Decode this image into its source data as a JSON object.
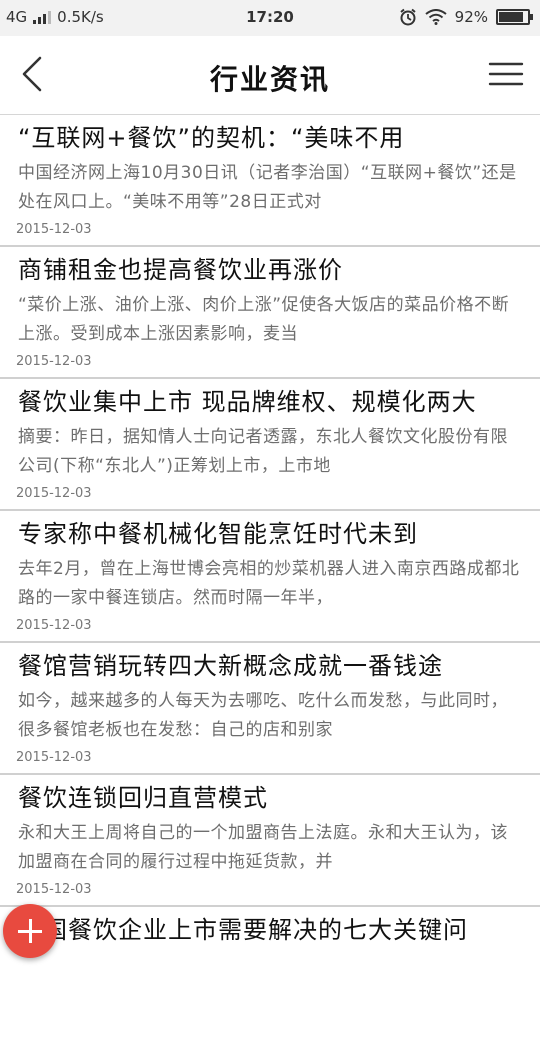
{
  "status_bar": {
    "network": "4G",
    "speed": "0.5K/s",
    "time": "17:20",
    "battery": "92%",
    "battery_level": 0.92,
    "icons": [
      "signal-icon",
      "alarm-icon",
      "wifi-icon",
      "battery-icon"
    ]
  },
  "header": {
    "title": "行业资讯",
    "back_icon": "back-icon",
    "menu_icon": "menu-icon"
  },
  "news": [
    {
      "title": "“互联网+餐饮”的契机：“美味不用",
      "summary": "中国经济网上海10月30日讯（记者李治国）“互联网+餐饮”还是处在风口上。“美味不用等”28日正式对",
      "date": "2015-12-03"
    },
    {
      "title": "商铺租金也提高餐饮业再涨价",
      "summary": "“菜价上涨、油价上涨、肉价上涨”促使各大饭店的菜品价格不断上涨。受到成本上涨因素影响，麦当",
      "date": "2015-12-03"
    },
    {
      "title": "餐饮业集中上市 现品牌维权、规模化两大",
      "summary": "摘要：昨日，据知情人士向记者透露，东北人餐饮文化股份有限公司(下称“东北人”)正筹划上市，上市地",
      "date": "2015-12-03"
    },
    {
      "title": "专家称中餐机械化智能烹饪时代未到",
      "summary": "去年2月，曾在上海世博会亮相的炒菜机器人进入南京西路成都北路的一家中餐连锁店。然而时隔一年半，",
      "date": "2015-12-03"
    },
    {
      "title": "餐馆营销玩转四大新概念成就一番钱途",
      "summary": "如今，越来越多的人每天为去哪吃、吃什么而发愁，与此同时，很多餐馆老板也在发愁：自己的店和别家",
      "date": "2015-12-03"
    },
    {
      "title": "餐饮连锁回归直营模式",
      "summary": "永和大王上周将自己的一个加盟商告上法庭。永和大王认为，该加盟商在合同的履行过程中拖延货款，并",
      "date": "2015-12-03"
    },
    {
      "title": "中国餐饮企业上市需要解决的七大关键问",
      "summary": "",
      "date": ""
    }
  ],
  "fab": {
    "icon": "plus-icon",
    "color": "#e84a3f"
  },
  "colors": {
    "accent": "#e84a3f",
    "divider": "#d0d0d0",
    "summary_text": "#6e6e6e"
  }
}
